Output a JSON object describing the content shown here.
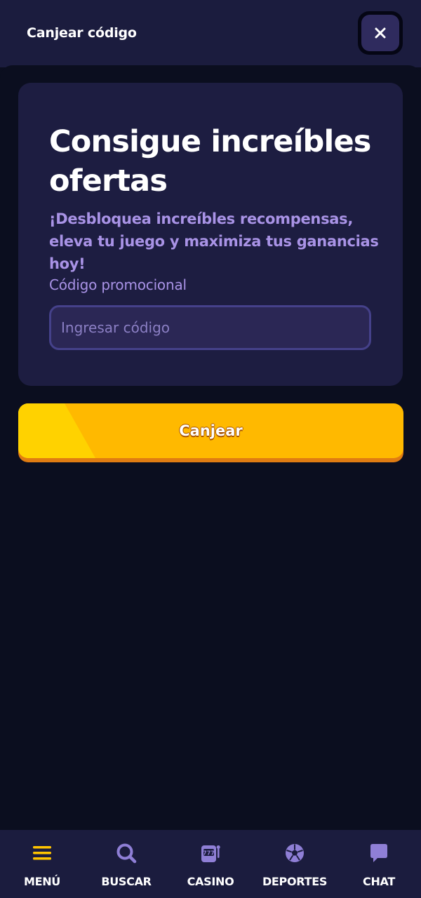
{
  "header": {
    "title": "Canjear código",
    "close_icon": "close-icon"
  },
  "promo": {
    "title": "Consigue increíbles ofertas",
    "subtitle": "¡Desbloquea increíbles recompensas, eleva tu juego y maximiza tus ganancias hoy!",
    "field_label": "Código promocional",
    "input_value": "",
    "input_placeholder": "Ingresar código",
    "button_label": "Canjear"
  },
  "bottom_nav": {
    "items": [
      {
        "label": "MENÚ",
        "icon": "menu-icon"
      },
      {
        "label": "BUSCAR",
        "icon": "search-icon"
      },
      {
        "label": "CASINO",
        "icon": "slot-machine-icon"
      },
      {
        "label": "DEPORTES",
        "icon": "soccer-ball-icon"
      },
      {
        "label": "CHAT",
        "icon": "chat-bubble-icon"
      }
    ]
  },
  "colors": {
    "background": "#0b0e1f",
    "header": "#1b1c3e",
    "card": "#1d1d41",
    "accent_text": "#a993e6",
    "button_yellow": "#ffb900",
    "button_shadow": "#e07c12",
    "menu_icon": "#ffc400",
    "nav_icon": "#8f7fd6"
  }
}
